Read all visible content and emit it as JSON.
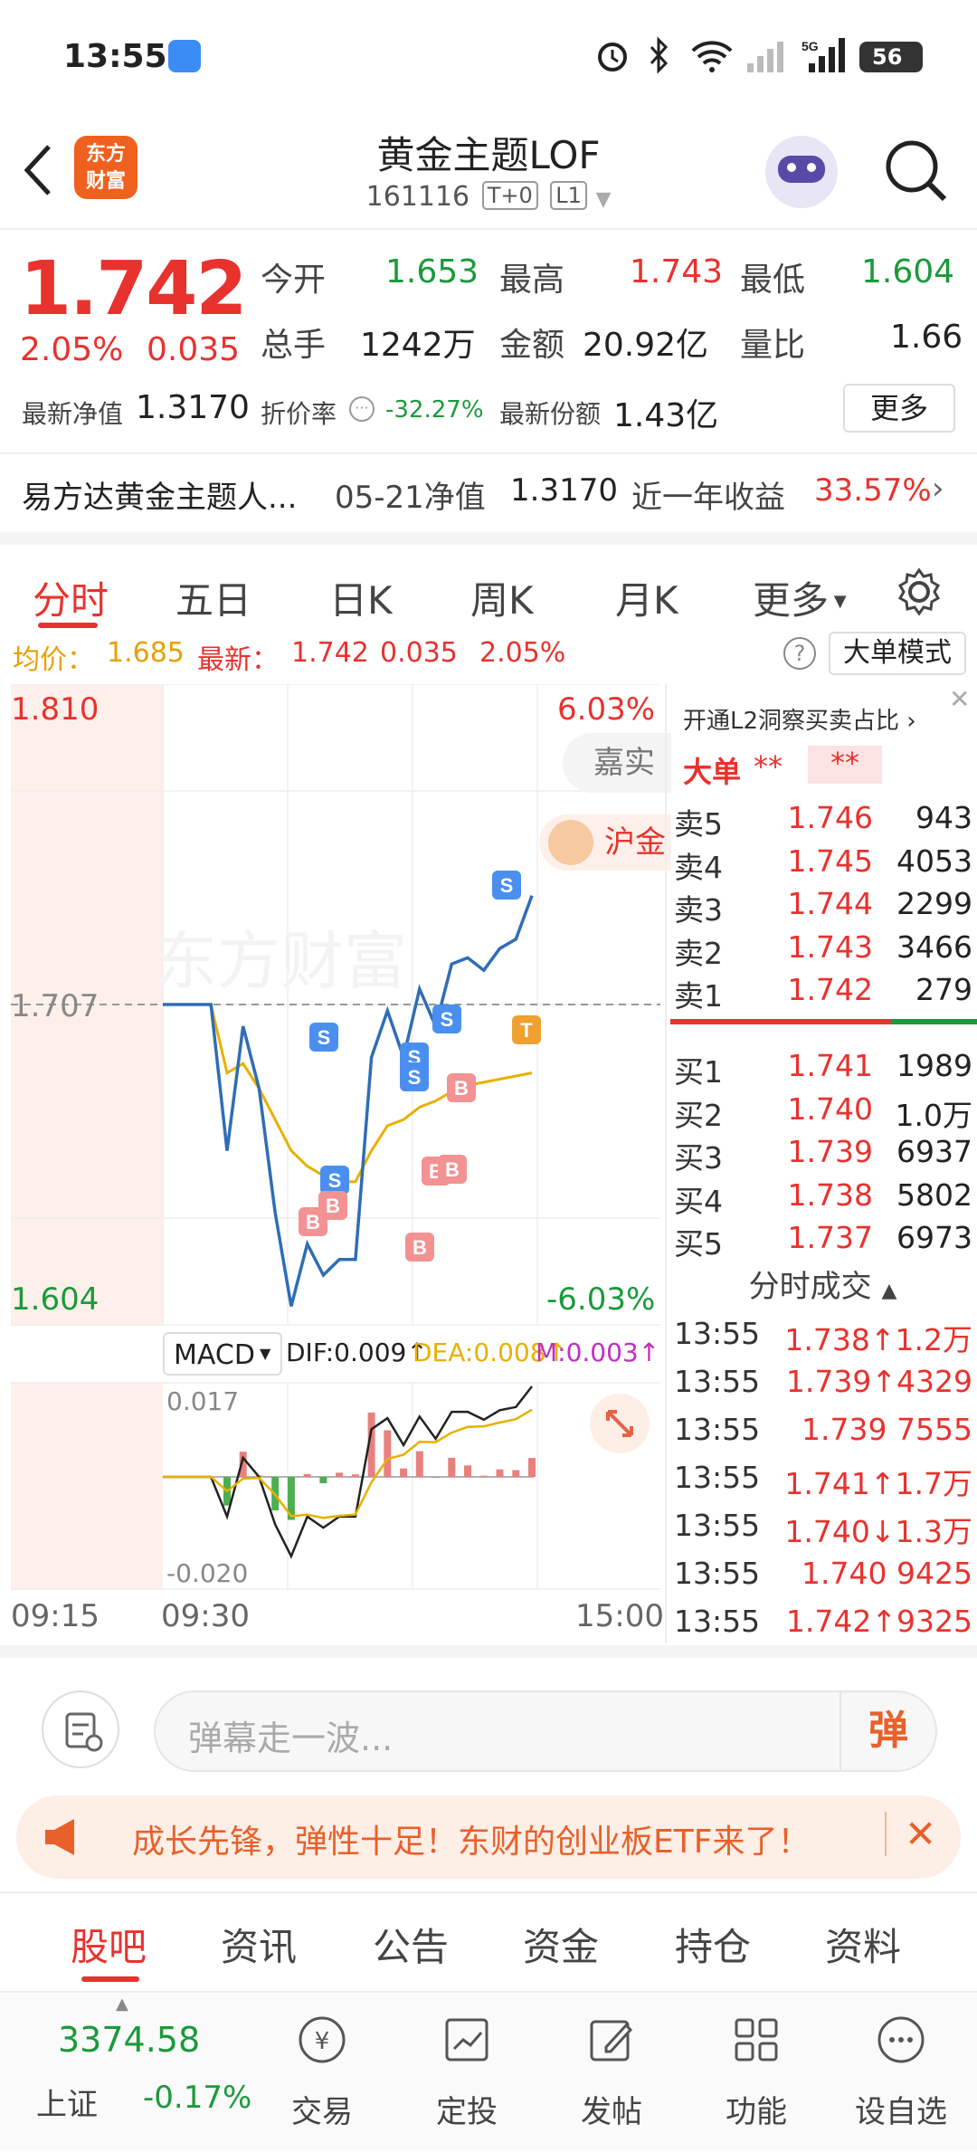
{
  "status": {
    "time": "13:55",
    "battery": "56"
  },
  "header": {
    "title": "黄金主题LOF",
    "code": "161116",
    "tag1": "T+0",
    "tag2": "L1",
    "logo_line1": "东方",
    "logo_line2": "财富"
  },
  "quote": {
    "price": "1.742",
    "pct": "2.05%",
    "chg": "0.035",
    "open_label": "今开",
    "open": "1.653",
    "high_label": "最高",
    "high": "1.743",
    "low_label": "最低",
    "low": "1.604",
    "vol_label": "总手",
    "vol": "1242万",
    "amt_label": "金额",
    "amt": "20.92亿",
    "ratio_label": "量比",
    "ratio": "1.66",
    "nav_label": "最新净值",
    "nav": "1.3170",
    "discount_label": "折价率",
    "discount": "-32.27%",
    "shares_label": "最新份额",
    "shares": "1.43亿",
    "more": "更多",
    "fund_name": "易方达黄金主题人...",
    "nav_date_label": "05-21净值",
    "nav_date_val": "1.3170",
    "year_label": "近一年收益",
    "year_val": "33.57%"
  },
  "chart_tabs": [
    "分时",
    "五日",
    "日K",
    "周K",
    "月K",
    "更多"
  ],
  "info": {
    "avg_label": "均价：",
    "avg": "1.685",
    "latest_label": "最新：",
    "latest": "1.742",
    "chg": "0.035",
    "pct": "2.05%",
    "mode": "大单模式"
  },
  "chart": {
    "y_top": "1.810",
    "y_mid": "1.707",
    "y_bot": "1.604",
    "pct_top": "6.03%",
    "pct_bot": "-6.03%",
    "tag_jiashi": "嘉实",
    "tag_hujin": "沪金",
    "macd_label": "MACD",
    "dif": "DIF:0.009↑",
    "dea": "DEA:0.008↑",
    "m": "M:0.003↑",
    "macd_top": "0.017",
    "macd_bot": "-0.020",
    "t_start": "09:15",
    "t_open": "09:30",
    "t_end": "15:00",
    "watermark": "东方财富"
  },
  "chart_data": {
    "type": "line",
    "title": "",
    "xlabel": "",
    "ylabel": "",
    "ylim": [
      1.604,
      1.81
    ],
    "series": [
      {
        "name": "",
        "x": [
          "09:30",
          "09:31",
          "09:32",
          "09:33",
          "09:34",
          "09:36",
          "09:38",
          "09:40",
          "09:42",
          "09:45",
          "09:48",
          "09:50",
          "09:55",
          "10:00",
          "10:03",
          "10:06",
          "10:09",
          "10:12",
          "10:15",
          "10:18",
          "10:21",
          "10:24",
          "10:27",
          "10:30"
        ],
        "values": [
          1.707,
          1.707,
          1.707,
          1.707,
          1.66,
          1.7,
          1.68,
          1.64,
          1.61,
          1.63,
          1.62,
          1.625,
          1.625,
          1.69,
          1.705,
          1.69,
          1.712,
          1.7,
          1.72,
          1.722,
          1.718,
          1.725,
          1.728,
          1.742
        ]
      },
      {
        "name": "均价",
        "values": [
          1.707,
          1.707,
          1.707,
          1.707,
          1.685,
          1.688,
          1.68,
          1.67,
          1.66,
          1.655,
          1.652,
          1.65,
          1.65,
          1.66,
          1.668,
          1.67,
          1.674,
          1.676,
          1.679,
          1.681,
          1.682,
          1.683,
          1.684,
          1.685
        ]
      }
    ],
    "macd": {
      "dif": 0.009,
      "dea": 0.008,
      "m": 0.003,
      "ylim": [
        -0.02,
        0.017
      ]
    }
  },
  "orderbook": {
    "header": "开通L2洞察买卖占比",
    "bigorder": "大单",
    "stars1": "**",
    "stars2": "**",
    "sells": [
      {
        "name": "卖5",
        "price": "1.746",
        "vol": "943"
      },
      {
        "name": "卖4",
        "price": "1.745",
        "vol": "4053"
      },
      {
        "name": "卖3",
        "price": "1.744",
        "vol": "2299"
      },
      {
        "name": "卖2",
        "price": "1.743",
        "vol": "3466"
      },
      {
        "name": "卖1",
        "price": "1.742",
        "vol": "279"
      }
    ],
    "buys": [
      {
        "name": "买1",
        "price": "1.741",
        "vol": "1989"
      },
      {
        "name": "买2",
        "price": "1.740",
        "vol": "1.0万"
      },
      {
        "name": "买3",
        "price": "1.739",
        "vol": "6937"
      },
      {
        "name": "买4",
        "price": "1.738",
        "vol": "5802"
      },
      {
        "name": "买5",
        "price": "1.737",
        "vol": "6973"
      }
    ],
    "trades_title": "分时成交",
    "trades": [
      {
        "time": "13:55",
        "price": "1.738↑1.2万"
      },
      {
        "time": "13:55",
        "price": "1.739↑4329"
      },
      {
        "time": "13:55",
        "price": "1.739 7555"
      },
      {
        "time": "13:55",
        "price": "1.741↑1.7万"
      },
      {
        "time": "13:55",
        "price": "1.740↓1.3万"
      },
      {
        "time": "13:55",
        "price": "1.740 9425"
      },
      {
        "time": "13:55",
        "price": "1.742↑9325"
      }
    ]
  },
  "danmu": {
    "placeholder": "弹幕走一波...",
    "send": "弹"
  },
  "banner": {
    "text": "成长先锋，弹性十足！东财的创业板ETF来了！"
  },
  "bottom_tabs": [
    "股吧",
    "资讯",
    "公告",
    "资金",
    "持仓",
    "资料"
  ],
  "navbar": {
    "index_value": "3374.58",
    "index_name": "上证",
    "index_pct": "-0.17%",
    "items": [
      "交易",
      "定投",
      "发帖",
      "功能",
      "设自选"
    ]
  }
}
